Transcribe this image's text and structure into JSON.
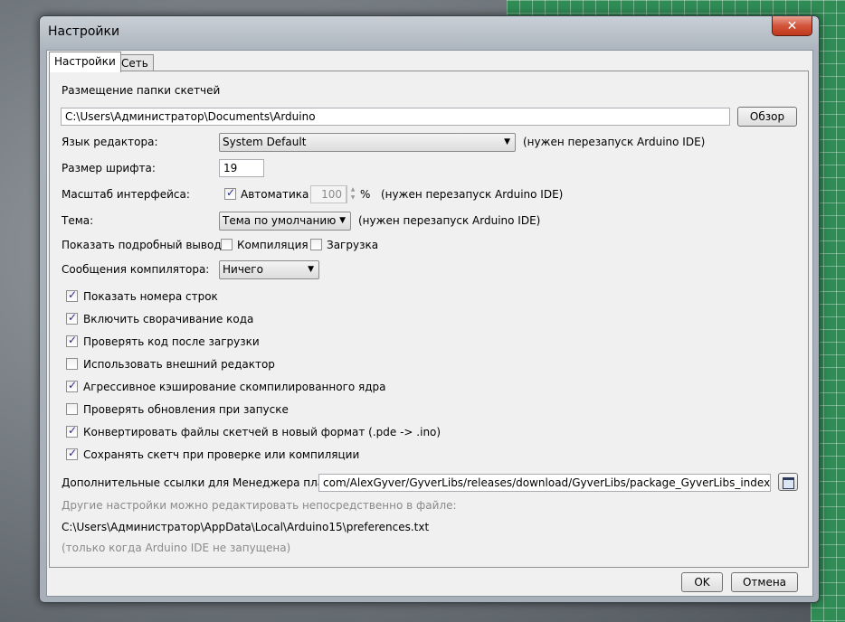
{
  "window": {
    "title": "Настройки",
    "close_label": "✕"
  },
  "tabs": [
    {
      "label": "Настройки",
      "active": true
    },
    {
      "label": "Сеть",
      "active": false
    }
  ],
  "sketchbook": {
    "label": "Размещение папки скетчей",
    "path": "C:\\Users\\Администратор\\Documents\\Arduino",
    "browse_label": "Обзор"
  },
  "editor_language": {
    "label": "Язык редактора:",
    "value": "System Default",
    "note": "(нужен перезапуск Arduino IDE)"
  },
  "font_size": {
    "label": "Размер шрифта:",
    "value": "19"
  },
  "interface_scale": {
    "label": "Масштаб интерфейса:",
    "auto_label": "Автоматика",
    "auto_checked": true,
    "value": "100",
    "unit": "%",
    "note": "(нужен перезапуск Arduino IDE)"
  },
  "theme": {
    "label": "Тема:",
    "value": "Тема по умолчанию",
    "note": "(нужен перезапуск Arduino IDE)"
  },
  "verbose": {
    "label": "Показать подробный вывод:",
    "compile_label": "Компиляция",
    "compile_checked": false,
    "upload_label": "Загрузка",
    "upload_checked": false
  },
  "compiler_warnings": {
    "label": "Сообщения компилятора:",
    "value": "Ничего"
  },
  "options": [
    {
      "label": "Показать номера строк",
      "checked": true
    },
    {
      "label": "Включить сворачивание кода",
      "checked": true
    },
    {
      "label": "Проверять код после загрузки",
      "checked": true
    },
    {
      "label": "Использовать внешний редактор",
      "checked": false
    },
    {
      "label": "Агрессивное кэширование скомпилированного ядра",
      "checked": true
    },
    {
      "label": "Проверять обновления при запуске",
      "checked": false
    },
    {
      "label": "Конвертировать файлы скетчей в новый формат (.pde -> .ino)",
      "checked": true
    },
    {
      "label": "Сохранять скетч при проверке или компиляции",
      "checked": true
    }
  ],
  "boards_manager": {
    "label": "Дополнительные ссылки для Менеджера плат:",
    "value": "com/AlexGyver/GyverLibs/releases/download/GyverLibs/package_GyverLibs_index.json"
  },
  "more_prefs": {
    "hint": "Другие настройки можно редактировать непосредственно в файле:",
    "path": "C:\\Users\\Администратор\\AppData\\Local\\Arduino15\\preferences.txt",
    "note": "(только когда Arduino IDE не запущена)"
  },
  "footer": {
    "ok_label": "OK",
    "cancel_label": "Отмена"
  },
  "colors": {
    "accent": "#2b2b8a",
    "close": "#c0391c",
    "background_grid": "#2f8c55"
  }
}
